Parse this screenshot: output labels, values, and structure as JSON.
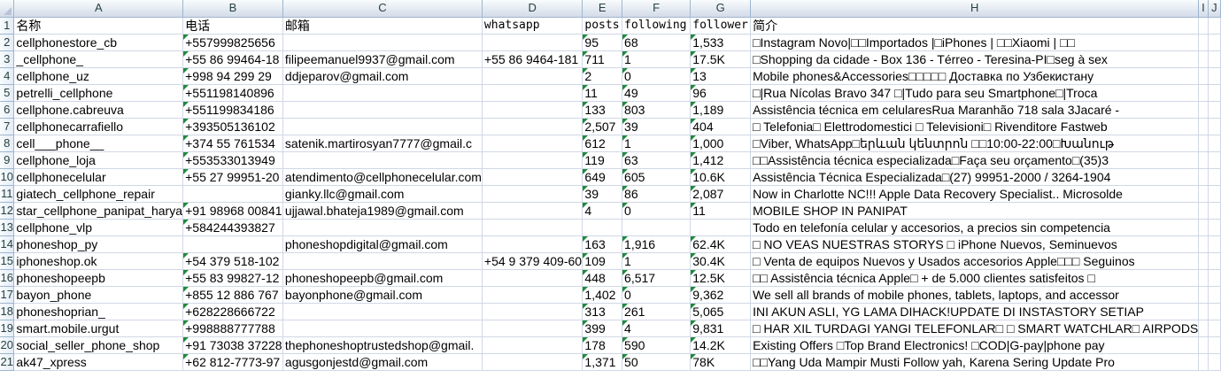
{
  "columns": [
    "A",
    "B",
    "C",
    "D",
    "E",
    "F",
    "G",
    "H",
    "I",
    "J"
  ],
  "rows": [
    {
      "n": "1",
      "a": "名称",
      "b": "电话",
      "c": "邮箱",
      "d": "whatsapp",
      "e": "posts",
      "f": "following",
      "g": "follower",
      "h": "简介"
    },
    {
      "n": "2",
      "a": "cellphonestore_cb",
      "b": "+557999825656",
      "c": "",
      "d": "",
      "e": "95",
      "f": "68",
      "g": "1,533",
      "h": "□Instagram Novo|□□Importados |□iPhones | □□Xiaomi | □□"
    },
    {
      "n": "3",
      "a": "_cellphone_",
      "b": "+55 86 99464-18",
      "c": "filipeemanuel9937@gmail.com",
      "d": "+55 86 9464-181",
      "e": "711",
      "f": "1",
      "g": "17.5K",
      "h": "□Shopping da cidade - Box 136 - Térreo - Teresina-PI□seg à sex"
    },
    {
      "n": "4",
      "a": "cellphone_uz",
      "b": "+998 94 299 29",
      "c": "ddjeparov@gmail.com",
      "d": "",
      "e": "2",
      "f": "0",
      "g": "13",
      "h": "Mobile phones&Accessories□□□□□ Доставка по Узбекистану"
    },
    {
      "n": "5",
      "a": "petrelli_cellphone",
      "b": "+551198140896",
      "c": "",
      "d": "",
      "e": "11",
      "f": "49",
      "g": "96",
      "h": "□|Rua Nícolas Bravo 347 □|Tudo para seu Smartphone□|Troca"
    },
    {
      "n": "6",
      "a": "cellphone.cabreuva",
      "b": "+551199834186",
      "c": "",
      "d": "",
      "e": "133",
      "f": "803",
      "g": "1,189",
      "h": "Assistência técnica em celularesRua Maranhão 718 sala 3Jacaré -"
    },
    {
      "n": "7",
      "a": "cellphonecarrafiello",
      "b": "+393505136102",
      "c": "",
      "d": "",
      "e": "2,507",
      "f": "39",
      "g": "404",
      "h": "□ Telefonia□ Elettrodomestici □ Televisioni□ Rivenditore Fastweb"
    },
    {
      "n": "8",
      "a": "cell___phone__",
      "b": "+374 55 761534",
      "c": "satenik.martirosyan7777@gmail.c",
      "d": "",
      "e": "612",
      "f": "1",
      "g": "1,000",
      "h": "□Viber, WhatsApp□երևան կենտրոն □□10:00-22:00□Խանութ"
    },
    {
      "n": "9",
      "a": "cellphone_loja",
      "b": "+553533013949",
      "c": "",
      "d": "",
      "e": "119",
      "f": "63",
      "g": "1,412",
      "h": "□□Assistência técnica especializada□Faça seu orçamento□(35)3"
    },
    {
      "n": "10",
      "a": "cellphonecelular",
      "b": "+55 27 99951-20",
      "c": "atendimento@cellphonecelular.com",
      "d": "",
      "e": "649",
      "f": "605",
      "g": "10.6K",
      "h": "Assistência Técnica Especializada□(27) 99951-2000 / 3264-1904"
    },
    {
      "n": "11",
      "a": "giatech_cellphone_repair",
      "b": "",
      "c": "gianky.llc@gmail.com",
      "d": "",
      "e": "39",
      "f": "86",
      "g": "2,087",
      "h": "Now in Charlotte NC!!! Apple Data Recovery Specialist.. Microsolde"
    },
    {
      "n": "12",
      "a": "star_cellphone_panipat_harya",
      "b": "+91 98968 00841",
      "c": "ujjawal.bhateja1989@gmail.com",
      "d": "",
      "e": "4",
      "f": "0",
      "g": "11",
      "h": "MOBILE SHOP IN PANIPAT"
    },
    {
      "n": "13",
      "a": "cellphone_vlp",
      "b": "+584244393827",
      "c": "",
      "d": "",
      "e": "",
      "f": "",
      "g": "",
      "h": "Todo en telefonía celular y accesorios, a precios sin competencia"
    },
    {
      "n": "14",
      "a": "phoneshop_py",
      "b": "",
      "c": "phoneshopdigital@gmail.com",
      "d": "",
      "e": "163",
      "f": "1,916",
      "g": "62.4K",
      "h": "□ NO VEAS NUESTRAS STORYS □       iPhone Nuevos, Seminuevos"
    },
    {
      "n": "15",
      "a": "iphoneshop.ok",
      "b": "+54 379 518-102",
      "c": "",
      "d": "+54 9 379 409-60",
      "e": "109",
      "f": "1",
      "g": "30.4K",
      "h": "□ Venta de equipos Nuevos y Usados accesorios Apple□□□ Seguinos"
    },
    {
      "n": "16",
      "a": "phoneshopeepb",
      "b": "+55 83 99827-12",
      "c": "phoneshopeepb@gmail.com",
      "d": "",
      "e": "448",
      "f": "6,517",
      "g": "12.5K",
      "h": "□□ Assistência técnica Apple□ + de 5.000 clientes satisfeitos □"
    },
    {
      "n": "17",
      "a": "bayon_phone",
      "b": "+855 12 886 767",
      "c": "bayonphone@gmail.com",
      "d": "",
      "e": "1,402",
      "f": "0",
      "g": "9,362",
      "h": "We sell all brands of mobile phones, tablets, laptops, and accessor"
    },
    {
      "n": "18",
      "a": "phoneshoprian_",
      "b": "+628228666722",
      "c": "",
      "d": "",
      "e": "313",
      "f": "261",
      "g": "5,065",
      "h": "INI AKUN ASLI, YG LAMA DIHACK!UPDATE DI INSTASTORY SETIAP"
    },
    {
      "n": "19",
      "a": "smart.mobile.urgut",
      "b": "+998888777788",
      "c": "",
      "d": "",
      "e": "399",
      "f": "4",
      "g": "9,831",
      "h": "□ HAR XIL TURDAGI YANGI TELEFONLAR□ □ SMART WATCHLAR□ AIRPODS"
    },
    {
      "n": "20",
      "a": "social_seller_phone_shop",
      "b": "+91 73038 37228",
      "c": "thephoneshoptrustedshop@gmail.",
      "d": "",
      "e": "178",
      "f": "590",
      "g": "14.2K",
      "h": "Existing Offers □Top Brand Electronics! □COD|G-pay|phone pay"
    },
    {
      "n": "21",
      "a": "ak47_xpress",
      "b": "+62 812-7773-97",
      "c": "agusgonjestd@gmail.com",
      "d": "",
      "e": "1,371",
      "f": "50",
      "g": "78K",
      "h": "□□Yang Uda Mampir Musti Follow yah, Karena Sering Update Pro"
    }
  ],
  "header_triangles": [
    "b",
    "e",
    "f",
    "g"
  ],
  "colors": {
    "header_border": "#9eb6ce",
    "grid": "#d0d7e5",
    "triangle": "#1e8a3c"
  }
}
